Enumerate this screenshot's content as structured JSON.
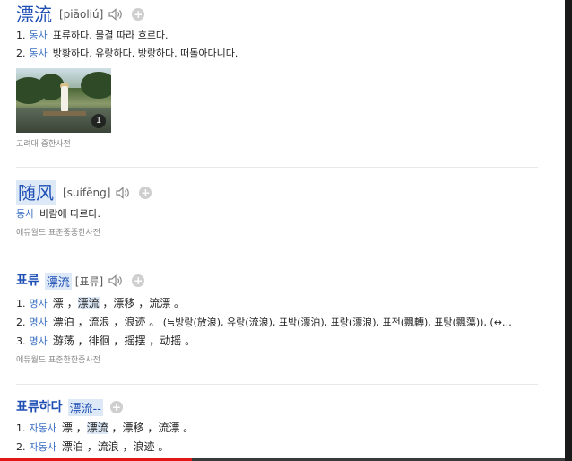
{
  "entry1": {
    "headword": "漂流",
    "pinyin": "[piāoliú]",
    "senses": [
      {
        "num": "1.",
        "pos": "동사",
        "text": "표류하다. 물결 따라 흐르다."
      },
      {
        "num": "2.",
        "pos": "동사",
        "text": "방황하다. 유랑하다. 방랑하다. 떠돌아다니다."
      }
    ],
    "image_count": "1",
    "source": "고려대 중한사전"
  },
  "entry2": {
    "headword": "随风",
    "pinyin": "[suífēng]",
    "senses": [
      {
        "pos": "동사",
        "text": "바람에 따르다."
      }
    ],
    "source": "에듀월드 표준중중한사전"
  },
  "entry3": {
    "headword": "표류",
    "hanzi": "漂流",
    "reading": "[표류]",
    "senses": [
      {
        "num": "1.",
        "pos": "명사",
        "parts": [
          "漂",
          " ，",
          "漂流",
          " ，漂移 ，流漂 。"
        ]
      },
      {
        "num": "2.",
        "pos": "명사",
        "parts": [
          "漂泊 ，流浪 ，浪迹 。",
          "(≒방랑(放浪), 유랑(流浪), 표박(漂泊), 표랑(漂浪), 표전(飄轉), 표탕(飄蕩)), (↔…"
        ]
      },
      {
        "num": "3.",
        "pos": "명사",
        "parts": [
          "游荡 ，徘徊 ，摇摆 ，动摇 。"
        ]
      }
    ],
    "source": "에듀월드 표준한한중사전"
  },
  "entry4": {
    "headword": "표류하다",
    "hanzi": "漂流--",
    "senses": [
      {
        "num": "1.",
        "pos": "자동사",
        "parts": [
          "漂 ，",
          "漂流",
          " ，漂移 ，流漂 。"
        ]
      },
      {
        "num": "2.",
        "pos": "자동사",
        "parts": [
          "漂泊 ，流浪 ，浪迹 。"
        ]
      }
    ]
  },
  "video": {
    "progress": 0.34
  },
  "colors": {
    "link": "#1f4fb5",
    "pos": "#3a6fc4",
    "highlight": "#dde9f7",
    "progress": "#e01818"
  }
}
